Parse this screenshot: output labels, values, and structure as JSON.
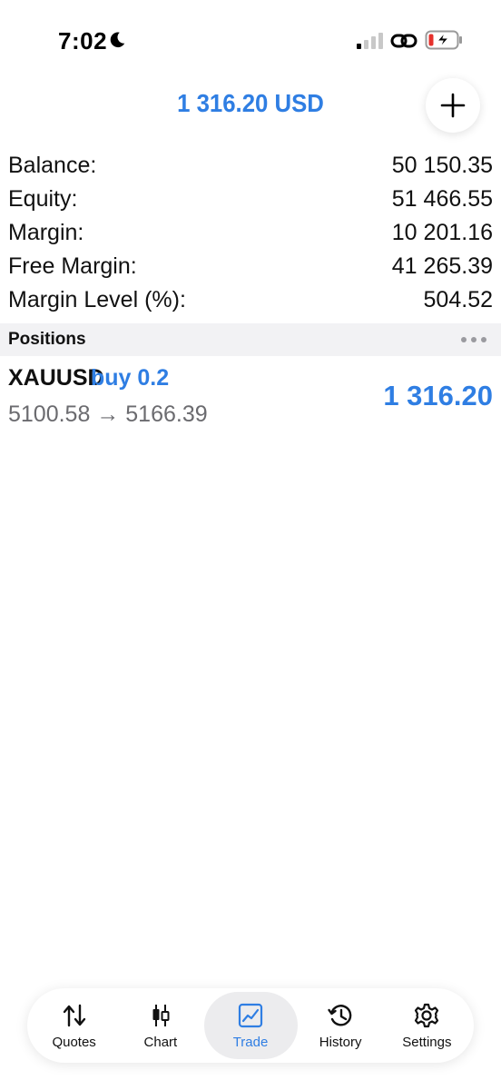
{
  "status_bar": {
    "time": "7:02"
  },
  "header": {
    "total": "1 316.20 USD"
  },
  "summary": [
    {
      "label": "Balance:",
      "value": "50 150.35"
    },
    {
      "label": "Equity:",
      "value": "51 466.55"
    },
    {
      "label": "Margin:",
      "value": "10 201.16"
    },
    {
      "label": "Free Margin:",
      "value": "41 265.39"
    },
    {
      "label": "Margin Level (%):",
      "value": "504.52"
    }
  ],
  "positions": {
    "title": "Positions",
    "items": [
      {
        "symbol": "XAUUSD",
        "side": "buy 0.2",
        "prices": "5100.58 → 5166.39",
        "profit": "1 316.20"
      }
    ]
  },
  "tabs": [
    {
      "label": "Quotes",
      "icon": "quotes-icon",
      "active": false
    },
    {
      "label": "Chart",
      "icon": "candlestick-icon",
      "active": false
    },
    {
      "label": "Trade",
      "icon": "trade-chart-icon",
      "active": true
    },
    {
      "label": "History",
      "icon": "history-icon",
      "active": false
    },
    {
      "label": "Settings",
      "icon": "gear-icon",
      "active": false
    }
  ],
  "colors": {
    "accent": "#2f7ee3",
    "secondary_text": "#6b6b6f",
    "section_bg": "#f2f2f4"
  }
}
